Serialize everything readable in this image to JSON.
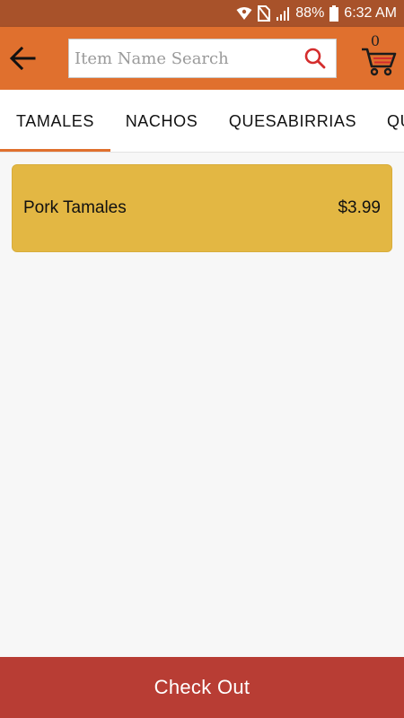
{
  "status_bar": {
    "battery": "88%",
    "time": "6:32 AM",
    "icons": [
      "wifi-icon",
      "no-sim-icon",
      "signal-icon",
      "battery-icon"
    ]
  },
  "header": {
    "search": {
      "placeholder": "Item Name Search",
      "value": ""
    },
    "cart_count": "0",
    "icons": [
      "back-arrow-icon",
      "search-icon",
      "cart-icon"
    ],
    "colors": {
      "app_bar": "#e0702e",
      "status_bar": "#a8522a",
      "search_icon": "#d42d2d"
    }
  },
  "tabs": [
    {
      "label": "TAMALES",
      "active": true
    },
    {
      "label": "NACHOS",
      "active": false
    },
    {
      "label": "QUESABIRRIAS",
      "active": false
    },
    {
      "label": "QU",
      "active": false
    }
  ],
  "items": [
    {
      "name": "Pork Tamales",
      "price": "$3.99"
    }
  ],
  "footer": {
    "checkout_label": "Check Out",
    "color": "#b83d34"
  }
}
